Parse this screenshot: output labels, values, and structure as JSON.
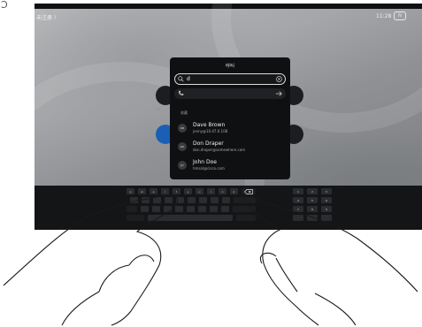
{
  "corner_glyph": "Ͻ",
  "status": {
    "left_label": "未注册 〉",
    "time": "11:28",
    "badge": "N"
  },
  "panel": {
    "title": "呼叫",
    "search_value": "d",
    "call_row_value": "d",
    "section_label": "收藏",
    "contacts": [
      {
        "initials": "DB",
        "name": "Dave Brown",
        "address": "jenny@10.47.6.108"
      },
      {
        "initials": "DD",
        "name": "Don Draper",
        "address": "don.draper@somewhere.com"
      },
      {
        "initials": "JD",
        "name": "John Doe",
        "address": "hmsol@cisco.com"
      }
    ]
  },
  "keyboard": {
    "row1": [
      "q",
      "w",
      "e",
      "r",
      "t",
      "y",
      "u",
      "i",
      "o",
      "p"
    ],
    "numpad": [
      "1",
      "2",
      "3",
      "4",
      "5",
      "6",
      "7",
      "8",
      "9"
    ]
  },
  "colors": {
    "panel": "#0f1012",
    "accent_blue": "#1b5fb5",
    "keyboard": "#141517"
  }
}
